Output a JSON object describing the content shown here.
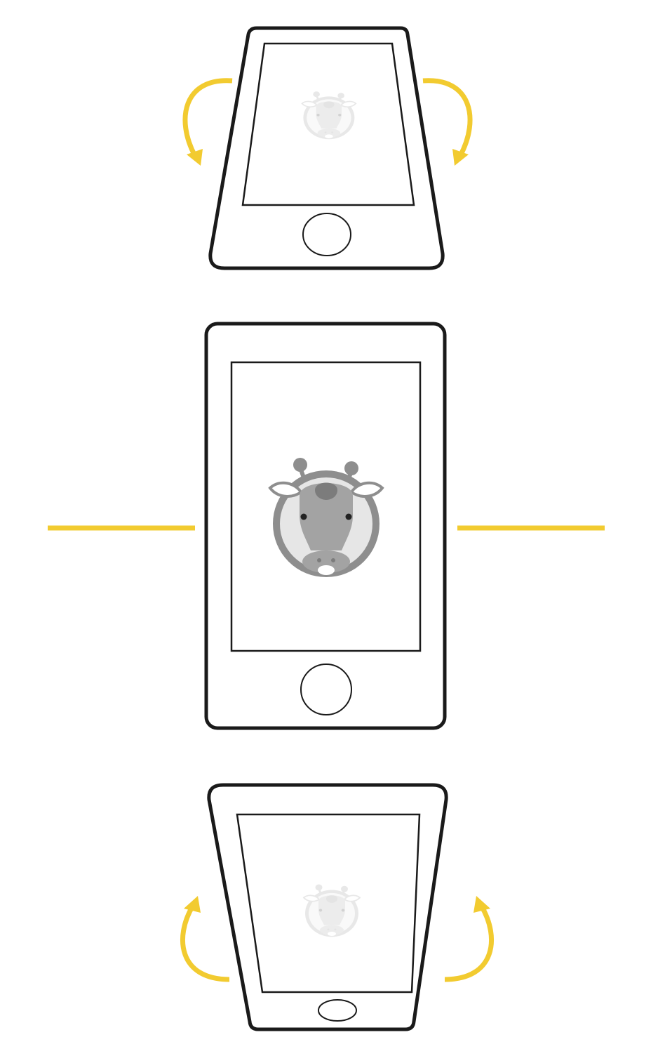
{
  "scene": {
    "description_label": "",
    "colors": {
      "accent": "#f2cb30",
      "outline": "#1a1a1a",
      "background": "#ffffff",
      "giraffe_ring": "#8e8e8e",
      "giraffe_fill": "#e6e6e6",
      "giraffe_face": "#a3a3a3",
      "giraffe_dark": "#7c7c7c",
      "giraffe_eye": "#222222"
    },
    "phones": [
      {
        "id": "tilted-back",
        "state": "tilted-back",
        "icon": "giraffe-icon",
        "icon_opacity": 0.2,
        "arrows": "curved-down"
      },
      {
        "id": "upright",
        "state": "upright",
        "icon": "giraffe-icon",
        "icon_opacity": 1,
        "arrows": "level-lines"
      },
      {
        "id": "tilted-forward",
        "state": "tilted-forward",
        "icon": "giraffe-icon",
        "icon_opacity": 0.2,
        "arrows": "curved-up"
      }
    ]
  }
}
